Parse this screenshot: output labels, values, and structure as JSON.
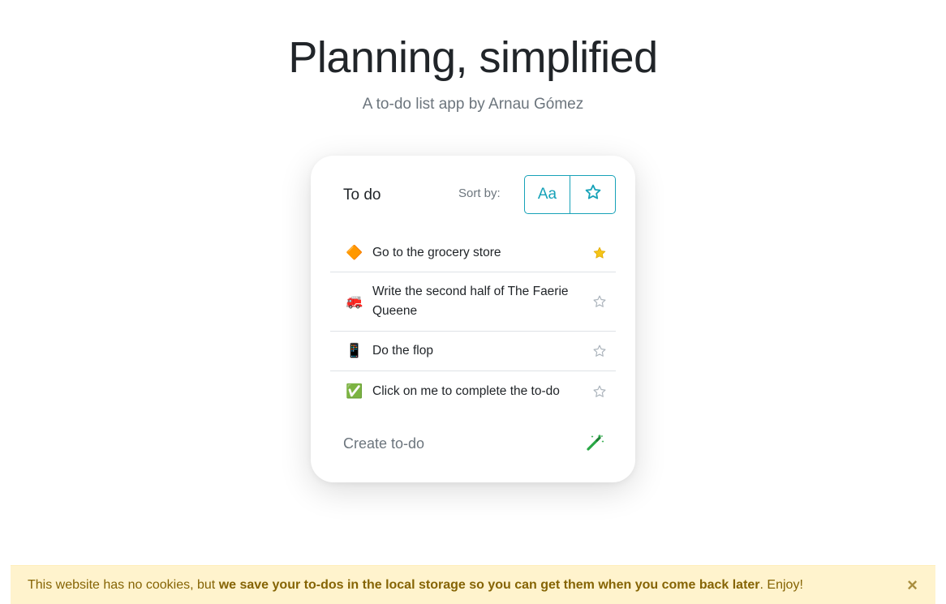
{
  "hero": {
    "title": "Planning, simplified",
    "subtitle": "A to-do list app by Arnau Gómez"
  },
  "card": {
    "title": "To do",
    "sort_label": "Sort by:",
    "sort_alpha_label": "Aa",
    "sort_star_icon": "star-outline-icon",
    "accent_color": "#17a2b8"
  },
  "todos": [
    {
      "emoji": "🔶",
      "emoji_name": "orange-diamond-icon",
      "text": "Go to the grocery store",
      "starred": true
    },
    {
      "emoji": "🚒",
      "emoji_name": "fire-engine-icon",
      "text": "Write the second half of The Faerie Queene",
      "starred": false
    },
    {
      "emoji": "📱",
      "emoji_name": "mobile-phone-icon",
      "text": "Do the flop",
      "starred": false
    },
    {
      "emoji": "✅",
      "emoji_name": "check-mark-icon",
      "text": "Click on me to complete the to-do",
      "starred": false
    }
  ],
  "create": {
    "label": "Create to-do",
    "icon": "magic-wand-icon",
    "icon_color": "#28a745"
  },
  "cookie_banner": {
    "text_start": "This website has no cookies, but ",
    "text_bold": "we save your to-dos in the local storage so you can get them when you come back later",
    "text_end": ". Enjoy!",
    "close_label": "×",
    "background": "#fff3cd",
    "text_color": "#856404"
  },
  "colors": {
    "star_filled": "#f5c518",
    "star_outline": "#adb5bd"
  }
}
